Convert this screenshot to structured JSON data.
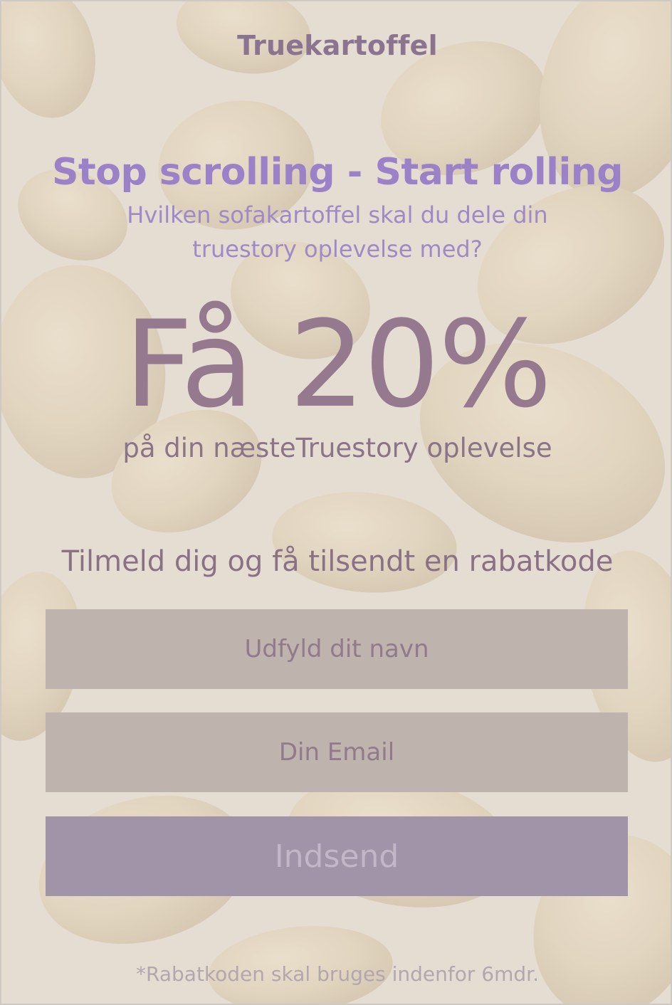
{
  "brand": "Truekartoffel",
  "headline": "Stop scrolling - Start rolling",
  "subline": "Hvilken sofakartoffel skal du dele din truestory oplevelse med?",
  "offer": {
    "big": "Få 20%",
    "sub": "på din næsteTruestory oplevelse"
  },
  "signup": {
    "lead": "Tilmeld dig og få tilsendt en rabatkode",
    "name_placeholder": "Udfyld dit navn",
    "email_placeholder": "Din Email",
    "submit_label": "Indsend"
  },
  "disclaimer": "*Rabatkoden skal bruges indenfor 6mdr.",
  "colors": {
    "background": "#e6ddd2",
    "headline": "#9b82c8",
    "brand": "#8b7490",
    "field": "#bfb3ad",
    "button": "#a193a8"
  },
  "background_image": "potato-pattern"
}
